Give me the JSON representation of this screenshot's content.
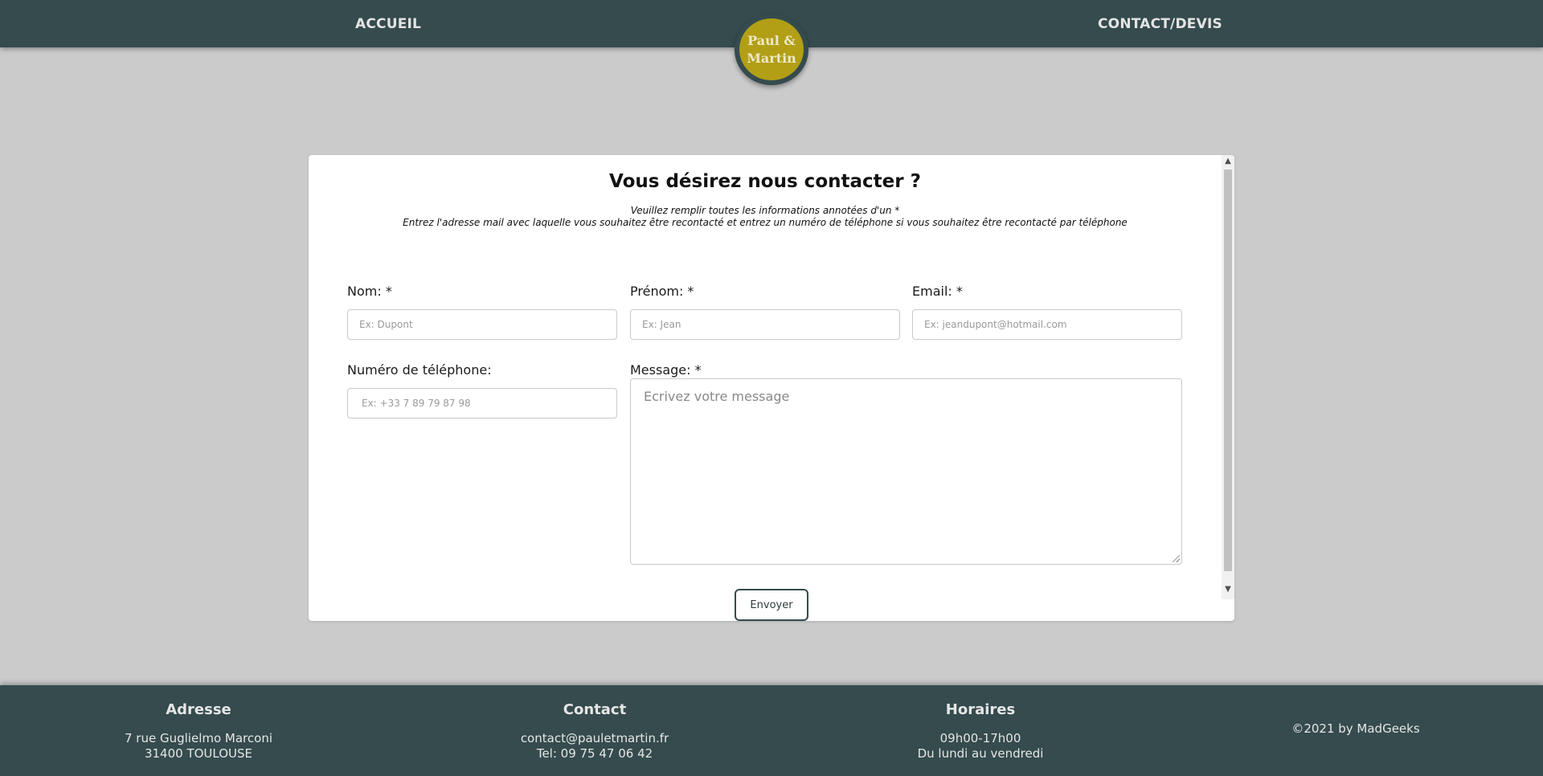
{
  "nav": {
    "left_link": "ACCUEIL",
    "right_link": "CONTACT/DEVIS",
    "logo_line1": "Paul &",
    "logo_line2": "Martin"
  },
  "form": {
    "title": "Vous désirez nous contacter ?",
    "subtitle_1": "Veuillez remplir toutes les informations annotées d'un *",
    "subtitle_2": "Entrez l'adresse mail avec laquelle vous souhaitez être recontacté et entrez un numéro de téléphone si vous souhaitez être recontacté par téléphone",
    "nom": {
      "label": "Nom: *",
      "placeholder": "Ex: Dupont"
    },
    "prenom": {
      "label": "Prénom: *",
      "placeholder": "Ex: Jean"
    },
    "email": {
      "label": "Email: *",
      "placeholder": "Ex: jeandupont@hotmail.com"
    },
    "telephone": {
      "label": "Numéro de téléphone:",
      "placeholder": "Ex: +33 7 89 79 87 98"
    },
    "message": {
      "label": "Message: *",
      "placeholder": "Ecrivez votre message"
    },
    "submit_label": "Envoyer"
  },
  "footer": {
    "adresse": {
      "heading": "Adresse",
      "line1": "7 rue Guglielmo Marconi",
      "line2": "31400 TOULOUSE"
    },
    "contact": {
      "heading": "Contact",
      "line1": "contact@pauletmartin.fr",
      "line2": "Tel: 09 75 47 06 42"
    },
    "horaires": {
      "heading": "Horaires",
      "line1": "09h00-17h00",
      "line2": "Du lundi au vendredi"
    },
    "copyright": "©2021 by MadGeeks"
  },
  "colors": {
    "header_bg": "#354b4d",
    "logo_gold": "#b29f15",
    "page_bg": "#cbcbcb"
  },
  "icons": {
    "scroll_up": "chevron-up-icon",
    "scroll_down": "chevron-down-icon",
    "resize": "resize-grip-icon"
  }
}
